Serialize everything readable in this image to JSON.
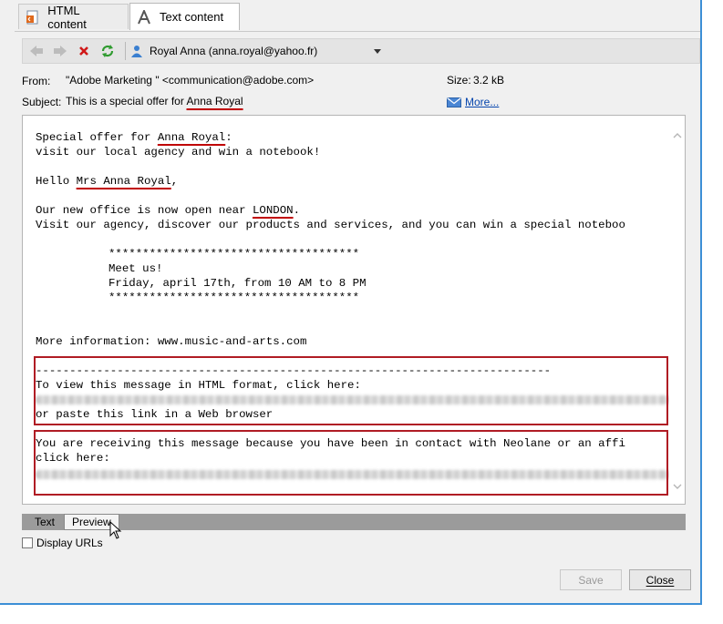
{
  "tabs": [
    {
      "label": "HTML content",
      "icon": "html-document-icon"
    },
    {
      "label": "Text content",
      "icon": "text-a-icon"
    }
  ],
  "toolbar": {
    "recipient": "Royal Anna (anna.royal@yahoo.fr)"
  },
  "header": {
    "from_label": "From:",
    "from_value": "\"Adobe Marketing \" <communication@adobe.com>",
    "subject_label": "Subject:",
    "subject_prefix": "This is a special offer for",
    "subject_name": "Anna Royal",
    "size_label": "Size:",
    "size_value": "3.2 kB",
    "more_link": "More..."
  },
  "message": {
    "line1_prefix": "Special offer for ",
    "line1_name": "Anna Royal",
    "line1_suffix": ":",
    "line2": "visit our local agency and win a notebook!",
    "hello_prefix": "Hello ",
    "hello_name": "Mrs Anna Royal",
    "hello_suffix": ",",
    "office_prefix": "Our new office is now open near ",
    "office_city": "LONDON",
    "office_suffix": ".",
    "visit_line": "Visit our agency, discover our products and services, and you can win a special noteboo",
    "stars1": "*************************************",
    "meet": "Meet us!",
    "date": "Friday, april 17th, from 10 AM to 8 PM",
    "stars2": "*************************************",
    "more_info": "More information: www.music-and-arts.com",
    "divider": "----------------------------------------------------------------------------",
    "html_format": "To view this message in HTML format, click here:",
    "paste": "or paste this link in a Web browser",
    "receiving": "You are receiving this message because you have been in contact with Neolane or an affi",
    "click_here": "click here:"
  },
  "view_tabs": {
    "text": "Text",
    "preview": "Preview"
  },
  "display_urls": "Display URLs",
  "buttons": {
    "save": "Save",
    "close": "Close"
  },
  "colors": {
    "highlight_red": "#b01c24",
    "link_blue": "#0645ad",
    "window_border": "#3c8fd6"
  }
}
